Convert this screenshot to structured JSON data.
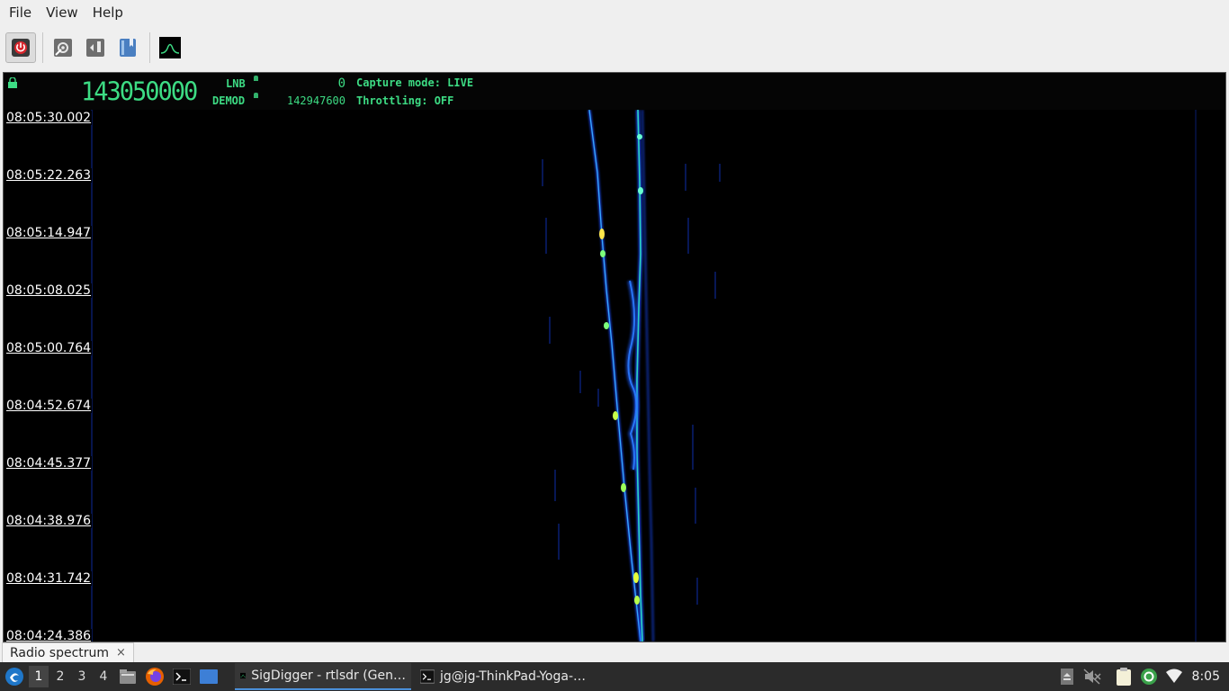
{
  "menu": [
    "File",
    "View",
    "Help"
  ],
  "toolbar": {
    "buttons": [
      {
        "name": "power-icon",
        "active": true
      },
      {
        "name": "settings-icon",
        "active": false
      },
      {
        "name": "export-icon",
        "active": false
      },
      {
        "name": "bookmark-icon",
        "active": false
      },
      {
        "name": "spectrum-icon",
        "active": false
      }
    ]
  },
  "lcd": {
    "main_freq": "143050000",
    "lnb_label": "LNB",
    "lnb_value": "0",
    "demod_label": "DEMOD",
    "demod_value": "142947600",
    "capture_mode": "Capture mode: LIVE",
    "throttling": "Throttling: OFF",
    "color": "#3ddc84"
  },
  "waterfall": {
    "timestamps": [
      "08:05:30.002",
      "08:05:22.263",
      "08:05:14.947",
      "08:05:08.025",
      "08:05:00.764",
      "08:04:52.674",
      "08:04:45.377",
      "08:04:38.976",
      "08:04:31.742",
      "08:04:24.386"
    ]
  },
  "tabs": {
    "active_label": "Radio spectrum",
    "close_glyph": "×"
  },
  "taskbar": {
    "workspaces": [
      "1",
      "2",
      "3",
      "4"
    ],
    "active_workspace": "1",
    "tasks": [
      {
        "label": "SigDigger - rtlsdr (Gen…",
        "active": true
      },
      {
        "label": "jg@jg-ThinkPad-Yoga-…",
        "active": false
      }
    ],
    "clock": "8:05"
  }
}
